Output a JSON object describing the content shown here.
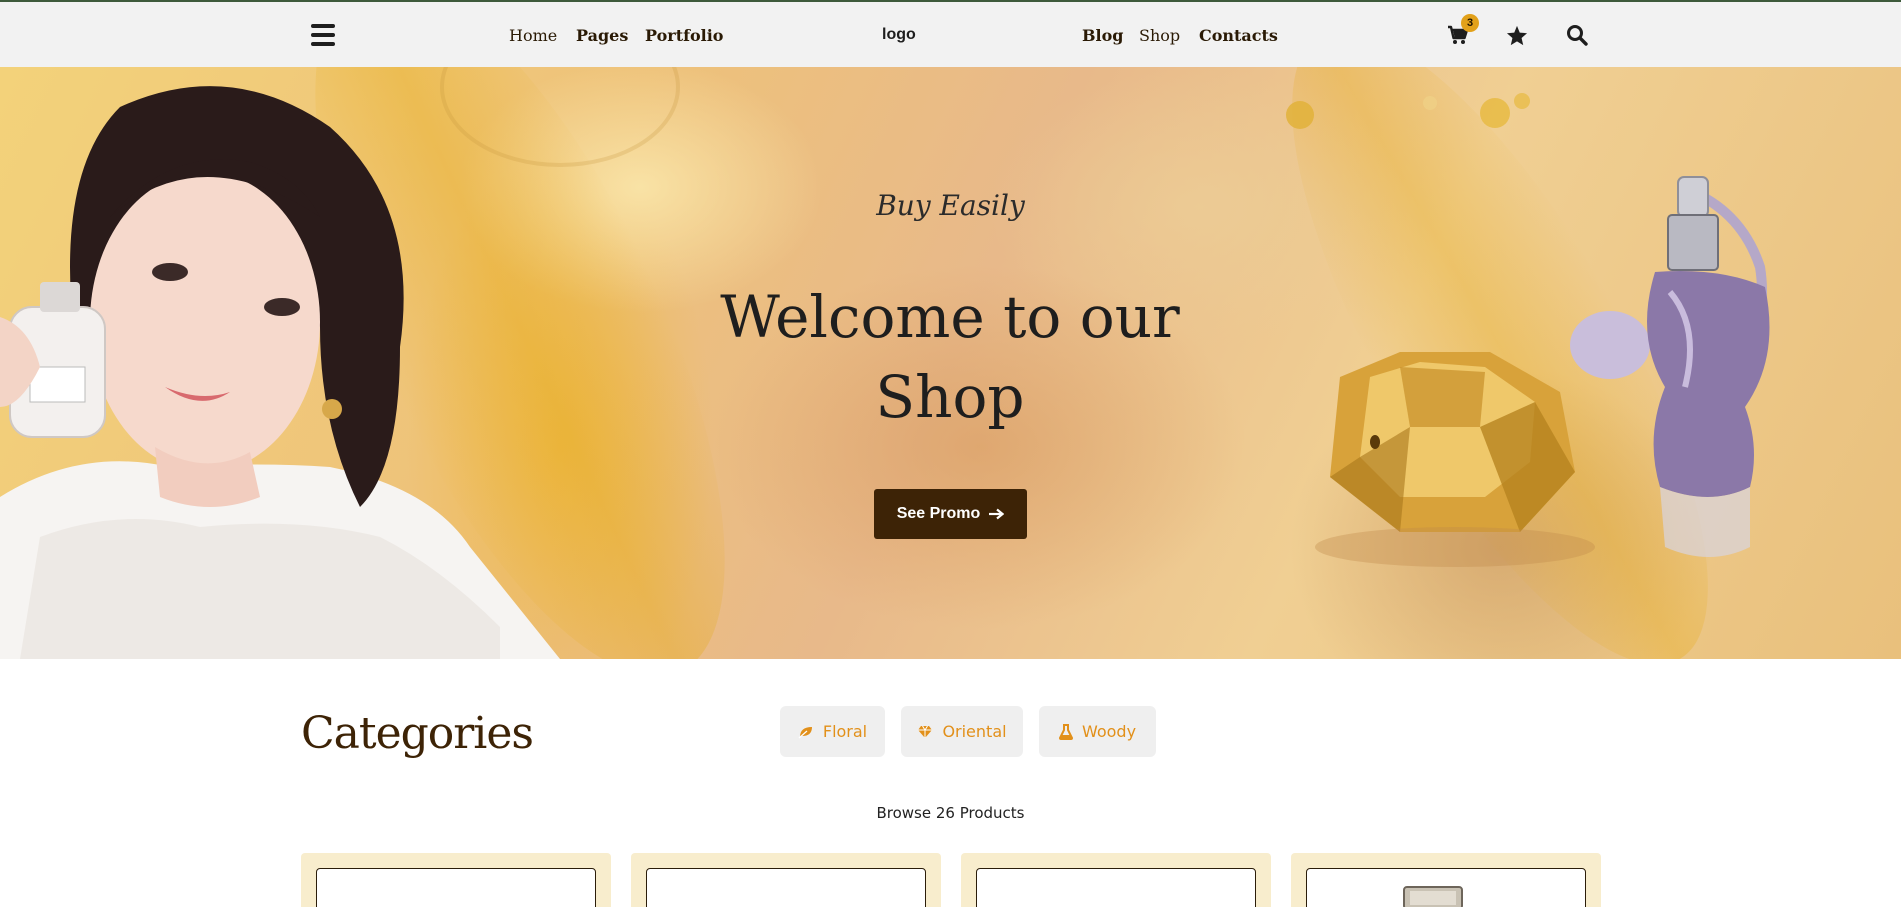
{
  "nav": {
    "links_left": [
      "Home",
      "Pages",
      "Portfolio"
    ],
    "logo": "logo",
    "links_right": [
      "Blog",
      "Shop",
      "Contacts"
    ],
    "cart_count": "3",
    "icons": [
      "menu-icon",
      "cart-icon",
      "star-icon",
      "search-icon"
    ]
  },
  "hero": {
    "tagline": "Buy Easily",
    "title_line1": "Welcome to our",
    "title_line2": "Shop",
    "button_label": "See Promo",
    "button_icon": "arrow-right-icon"
  },
  "categories": {
    "title": "Categories",
    "filters": [
      {
        "label": "Floral",
        "icon": "leaf-icon"
      },
      {
        "label": "Oriental",
        "icon": "gem-icon"
      },
      {
        "label": "Woody",
        "icon": "flask-icon"
      }
    ],
    "browse_text": "Browse 26 Products"
  },
  "colors": {
    "accent": "#e2901a",
    "brand_dark": "#3d2306",
    "card_bg": "#f8edcd",
    "nav_bg": "#f2f2f2"
  }
}
